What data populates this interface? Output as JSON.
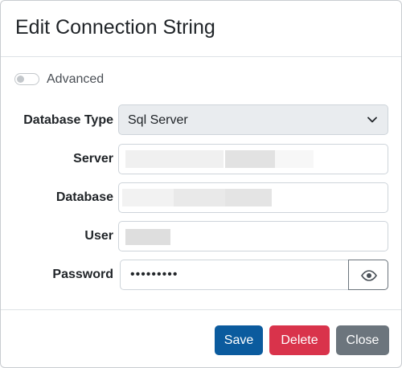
{
  "dialog": {
    "title": "Edit Connection String"
  },
  "advanced_toggle": {
    "label": "Advanced",
    "checked": false
  },
  "form": {
    "database_type": {
      "label": "Database Type",
      "value": "Sql Server"
    },
    "server": {
      "label": "Server",
      "value": ""
    },
    "database": {
      "label": "Database",
      "value": ""
    },
    "user": {
      "label": "User",
      "value": ""
    },
    "password": {
      "label": "Password",
      "value": "•••••••••"
    }
  },
  "footer": {
    "save_label": "Save",
    "delete_label": "Delete",
    "close_label": "Close"
  },
  "colors": {
    "save": "#0b5b9e",
    "delete": "#d9334b",
    "close": "#6c757d"
  },
  "icons": {
    "select_chevron": "chevron-down-icon",
    "password_reveal": "eye-icon"
  }
}
